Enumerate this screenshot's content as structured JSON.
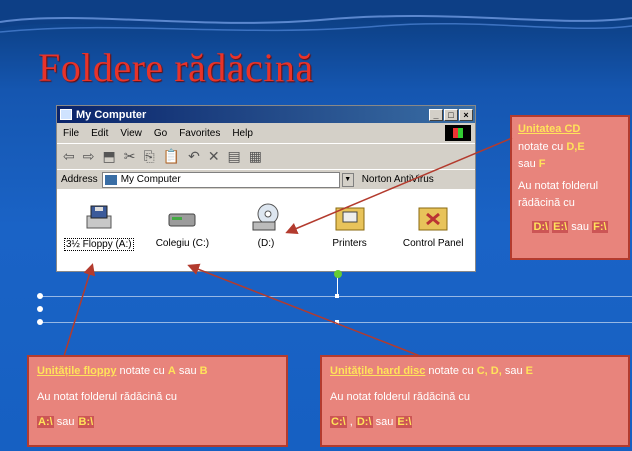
{
  "slide": {
    "title": "Foldere rădăcină"
  },
  "window": {
    "title": "My Computer",
    "controls": [
      "_",
      "□",
      "×"
    ],
    "menu": [
      "File",
      "Edit",
      "View",
      "Go",
      "Favorites",
      "Help"
    ],
    "address_label": "Address",
    "address_value": "My Computer",
    "norton_label": "Norton AntiVirus",
    "items": [
      {
        "label": "3½ Floppy (A:)",
        "icon": "floppy-drive-icon",
        "selected": true
      },
      {
        "label": "Colegiu (C:)",
        "icon": "hard-disk-icon",
        "selected": false
      },
      {
        "label": "(D:)",
        "icon": "cd-drive-icon",
        "selected": false
      },
      {
        "label": "Printers",
        "icon": "printers-folder-icon",
        "selected": false
      },
      {
        "label": "Control Panel",
        "icon": "control-panel-icon",
        "selected": false
      }
    ]
  },
  "callouts": {
    "cd": {
      "heading": "Unitatea CD",
      "line1": "notate cu ",
      "letters": "D,E",
      "line2a": "sau ",
      "letter2": "F",
      "text": "Au notat folderul rădăcină cu",
      "d1": "D:\\",
      "d2": "E:\\",
      "sep": " sau ",
      "d3": "F:\\"
    },
    "floppy": {
      "heading": "Unitățile floppy",
      "line1": " notate cu ",
      "a": "A",
      "sau": " sau ",
      "b": "B",
      "text": "Au notat folderul rădăcină cu",
      "d1": "A:\\",
      "sep": " sau ",
      "d2": "B:\\"
    },
    "hdd": {
      "heading": "Unitățile hard disc",
      "line1": " notate cu ",
      "letters": "C, D,",
      "sau": " sau ",
      "e": "E",
      "text": "Au notat folderul rădăcină cu",
      "d1": "C:\\",
      "comma": " , ",
      "d2": "D:\\",
      "sep": " sau ",
      "d3": "E:\\"
    }
  },
  "colors": {
    "title": "#e8332a",
    "callout_bg": "#e8847c",
    "highlight": "#ffe35a"
  }
}
